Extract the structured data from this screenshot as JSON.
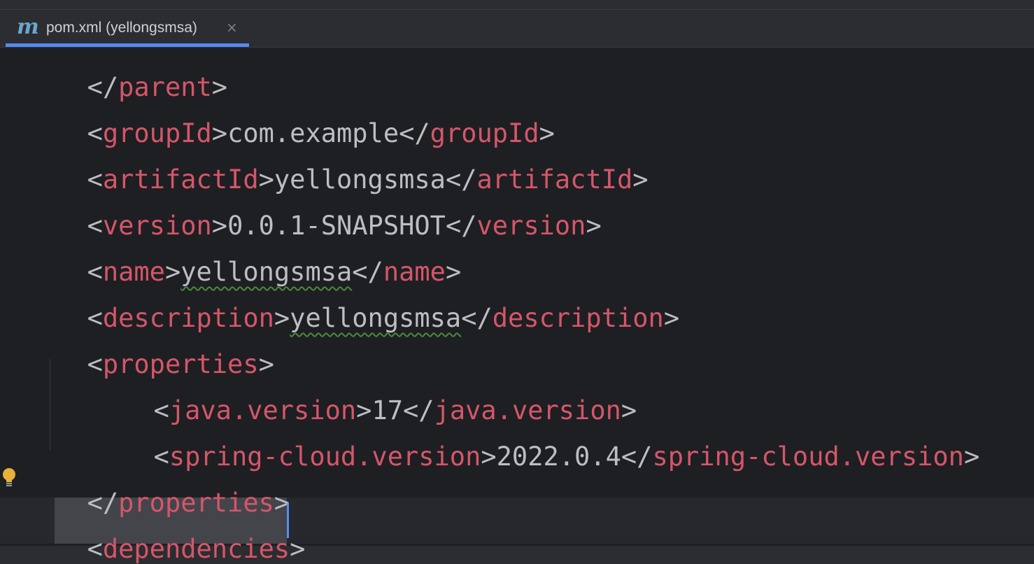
{
  "tab": {
    "icon": "maven-m-icon",
    "icon_glyph": "m",
    "label": "pom.xml (yellongsmsa)",
    "close_glyph": "×"
  },
  "editor": {
    "lines": [
      {
        "open": "</",
        "tag": "parent",
        "close": ">"
      },
      {
        "open": "<",
        "tag": "groupId",
        "mid": ">",
        "value": "com.example",
        "end_open": "</",
        "end_tag": "groupId",
        "end_close": ">"
      },
      {
        "open": "<",
        "tag": "artifactId",
        "mid": ">",
        "value": "yellongsmsa",
        "end_open": "</",
        "end_tag": "artifactId",
        "end_close": ">"
      },
      {
        "open": "<",
        "tag": "version",
        "mid": ">",
        "value": "0.0.1-SNAPSHOT",
        "end_open": "</",
        "end_tag": "version",
        "end_close": ">"
      },
      {
        "open": "<",
        "tag": "name",
        "mid": ">",
        "value": "yellongsmsa",
        "end_open": "</",
        "end_tag": "name",
        "end_close": ">"
      },
      {
        "open": "<",
        "tag": "description",
        "mid": ">",
        "value": "yellongsmsa",
        "end_open": "</",
        "end_tag": "description",
        "end_close": ">"
      },
      {
        "open": "<",
        "tag": "properties",
        "close": ">"
      },
      {
        "open": "<",
        "tag": "java.version",
        "mid": ">",
        "value": "17",
        "end_open": "</",
        "end_tag": "java.version",
        "end_close": ">"
      },
      {
        "open": "<",
        "tag": "spring-cloud.version",
        "mid": ">",
        "value": "2022.0.4",
        "end_open": "</",
        "end_tag": "spring-cloud.version",
        "end_close": ">"
      },
      {
        "open": "</",
        "tag": "properties",
        "close": ">"
      },
      {
        "open": "<",
        "tag": "dependencies",
        "close": ">"
      }
    ]
  },
  "gutter": {
    "intention_icon": "lightbulb-icon"
  },
  "colors": {
    "tag": "#d5566a",
    "bracket": "#bcbec4",
    "text": "#bcbec4",
    "accent": "#548af7",
    "bulb": "#e8b23a"
  }
}
